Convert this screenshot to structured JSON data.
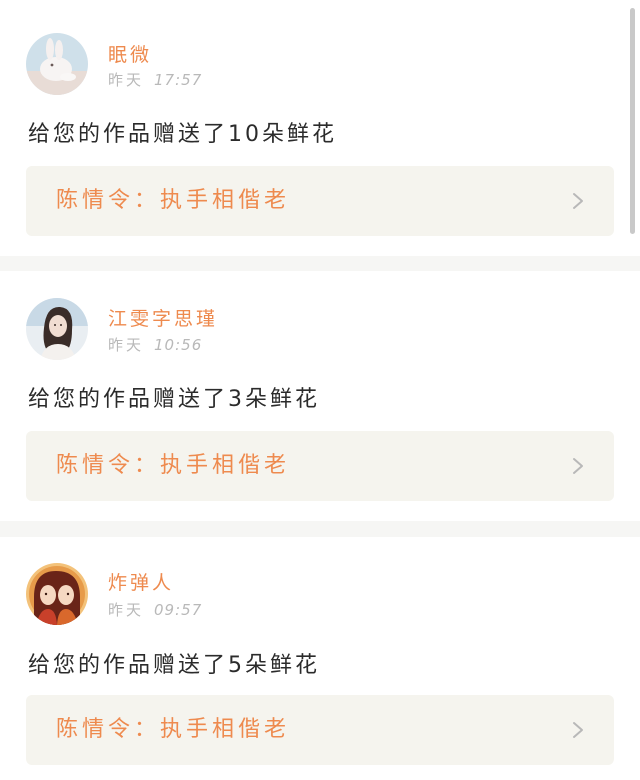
{
  "notifications": [
    {
      "username": "眠微",
      "day": "昨天",
      "time": "17:57",
      "message": "给您的作品赠送了10朵鲜花",
      "work_title": "陈情令：执手相偕老",
      "avatar": "rabbit-avatar"
    },
    {
      "username": "江雯字思瑾",
      "day": "昨天",
      "time": "10:56",
      "message": "给您的作品赠送了3朵鲜花",
      "work_title": "陈情令：执手相偕老",
      "avatar": "woman-avatar"
    },
    {
      "username": "炸弹人",
      "day": "昨天",
      "time": "09:57",
      "message": "给您的作品赠送了5朵鲜花",
      "work_title": "陈情令：执手相偕老",
      "avatar": "anime-avatar"
    }
  ],
  "colors": {
    "accent": "#ee8a4e",
    "link_background": "#f5f4ee",
    "divider": "#f6f6f4",
    "timestamp": "#b9b9b9",
    "text": "#2b2b2b"
  },
  "icons": {
    "link_arrow": "chevron-right-icon"
  }
}
